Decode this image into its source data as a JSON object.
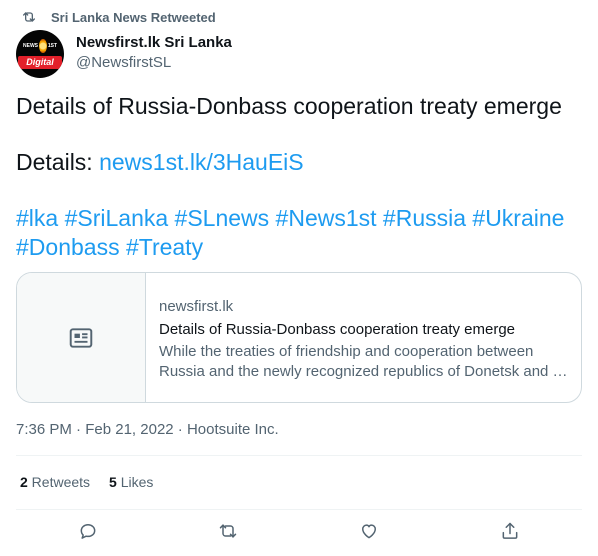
{
  "retweet_context": {
    "text": "Sri Lanka News Retweeted",
    "icon": "retweet-icon"
  },
  "author": {
    "display_name": "Newsfirst.lk Sri Lanka",
    "handle": "@NewsfirstSL",
    "avatar_badge": "Digital"
  },
  "tweet": {
    "line1": "Details of Russia-Donbass cooperation treaty emerge",
    "details_label": "Details: ",
    "details_link": "news1st.lk/3HauEiS",
    "hashtags_line1": "#lka #SriLanka #SLnews #News1st #Russia #Ukraine",
    "hashtags_line2": "#Donbass #Treaty"
  },
  "card": {
    "domain": "newsfirst.lk",
    "title": "Details of Russia-Donbass cooperation treaty emerge",
    "desc_line1": "While the treaties of friendship and cooperation between",
    "desc_line2": "Russia and the newly recognized republics of Donetsk and …",
    "thumb_icon": "article-icon"
  },
  "meta": {
    "time": "7:36 PM",
    "sep1": " · ",
    "date": "Feb 21, 2022",
    "sep2": " · ",
    "source": "Hootsuite Inc."
  },
  "stats": {
    "retweets_count": "2",
    "retweets_label": " Retweets",
    "likes_count": "5",
    "likes_label": " Likes"
  },
  "actions": [
    "reply-icon",
    "retweet-icon",
    "like-icon",
    "share-icon"
  ],
  "colors": {
    "link": "#1d9bf0",
    "secondary": "#536471",
    "border": "#cfd9de"
  }
}
